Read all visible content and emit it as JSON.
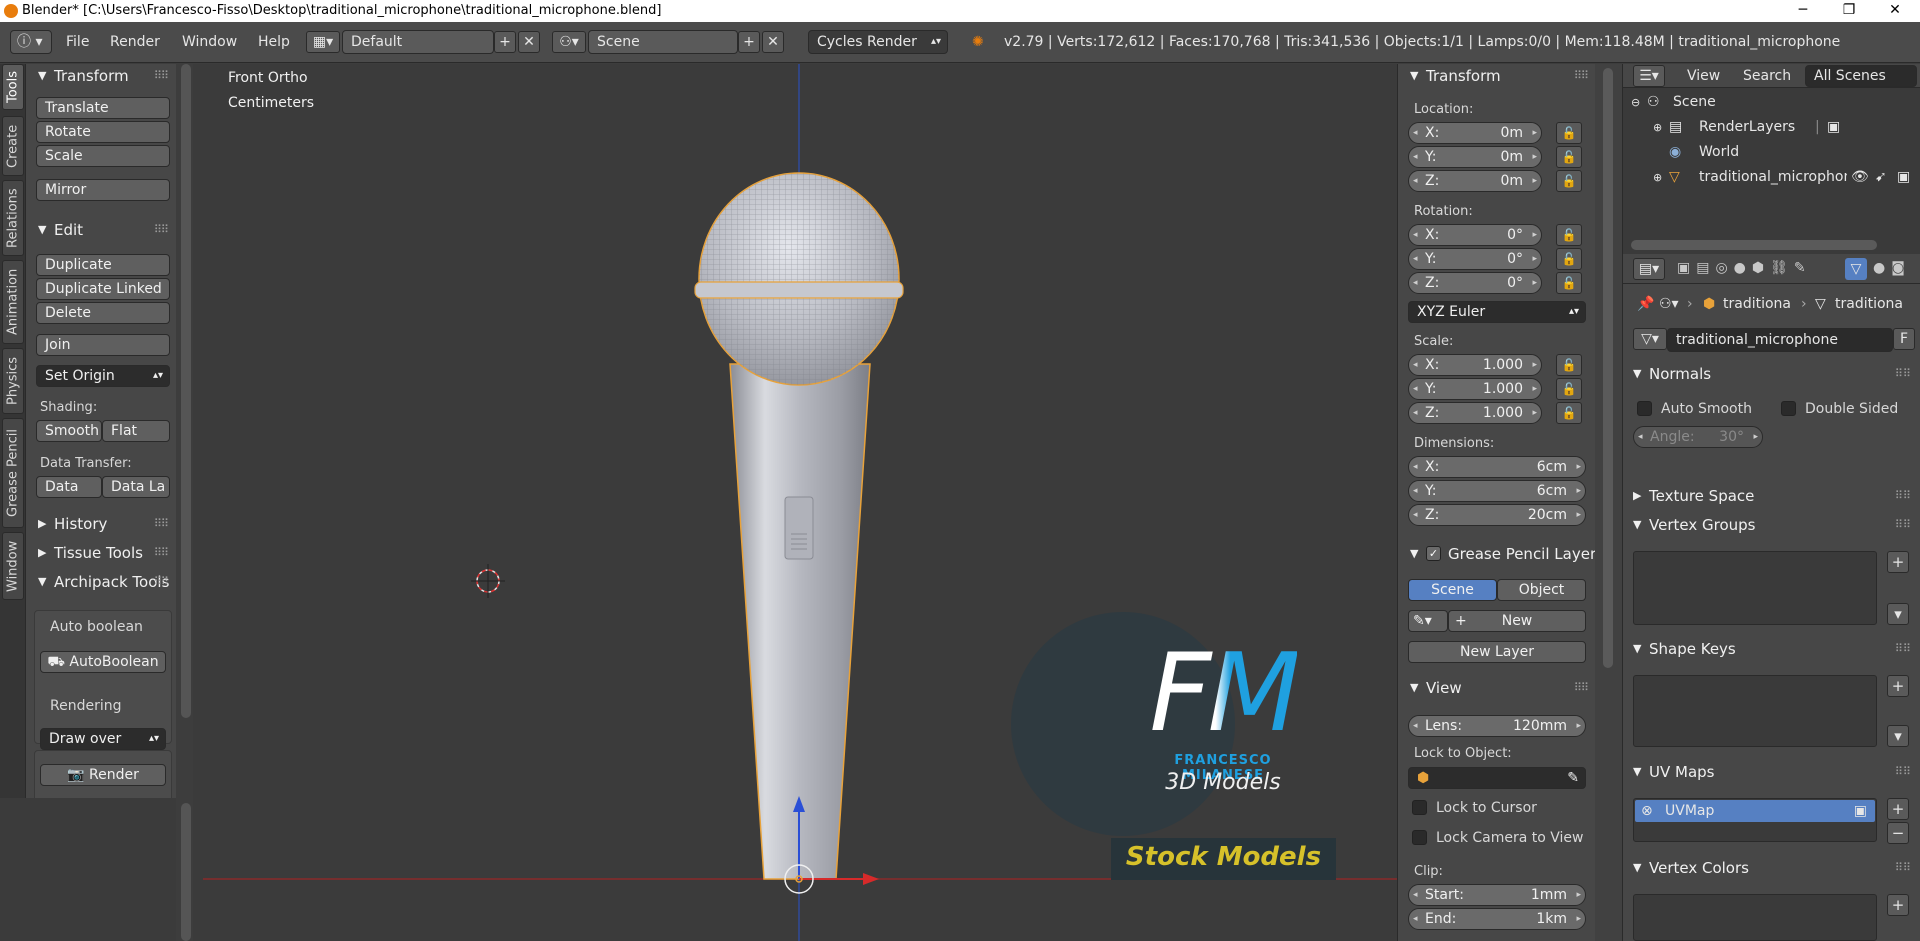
{
  "titlebar": {
    "title": "Blender* [C:\\Users\\Francesco-Fisso\\Desktop\\traditional_microphone\\traditional_microphone.blend]",
    "minimize": "─",
    "maximize": "❐",
    "close": "✕"
  },
  "menubar": {
    "info_icon": "ⓘ",
    "menus": [
      "File",
      "Render",
      "Window",
      "Help"
    ],
    "screen_layout": "Default",
    "scene": "Scene",
    "render_engine": "Cycles Render",
    "stats": "v2.79 | Verts:172,612 | Faces:170,768 | Tris:341,536 | Objects:1/1 | Lamps:0/0 | Mem:118.48M | traditional_microphone"
  },
  "left_tabs": [
    "Tools",
    "Create",
    "Relations",
    "Animation",
    "Physics",
    "Grease Pencil",
    "Window"
  ],
  "tool_shelf": {
    "transform": {
      "title": "Transform",
      "buttons": [
        "Translate",
        "Rotate",
        "Scale",
        "Mirror"
      ]
    },
    "edit": {
      "title": "Edit",
      "buttons": [
        "Duplicate",
        "Duplicate Linked",
        "Delete",
        "Join"
      ],
      "set_origin": "Set Origin",
      "shading_label": "Shading:",
      "smooth": "Smooth",
      "flat": "Flat",
      "data_transfer_label": "Data Transfer:",
      "data": "Data",
      "data_la": "Data La"
    },
    "history": "History",
    "tissue": "Tissue Tools",
    "archipack": "Archipack Tools",
    "auto_boolean_label": "Auto boolean",
    "auto_boolean_btn": "AutoBoolean",
    "rendering_label": "Rendering",
    "draw_over": "Draw over",
    "render_btn": "Render"
  },
  "viewport": {
    "view_name": "Front Ortho",
    "units": "Centimeters",
    "logo": {
      "letters": "FM",
      "name": "FRANCESCO MILANESE",
      "subtitle": "3D Models",
      "banner": "Stock Models"
    }
  },
  "npanel": {
    "transform_title": "Transform",
    "location_label": "Location:",
    "location": [
      {
        "k": "X:",
        "v": "0m"
      },
      {
        "k": "Y:",
        "v": "0m"
      },
      {
        "k": "Z:",
        "v": "0m"
      }
    ],
    "rotation_label": "Rotation:",
    "rotation": [
      {
        "k": "X:",
        "v": "0°"
      },
      {
        "k": "Y:",
        "v": "0°"
      },
      {
        "k": "Z:",
        "v": "0°"
      }
    ],
    "rotation_mode": "XYZ Euler",
    "scale_label": "Scale:",
    "scale": [
      {
        "k": "X:",
        "v": "1.000"
      },
      {
        "k": "Y:",
        "v": "1.000"
      },
      {
        "k": "Z:",
        "v": "1.000"
      }
    ],
    "dimensions_label": "Dimensions:",
    "dimensions": [
      {
        "k": "X:",
        "v": "6cm"
      },
      {
        "k": "Y:",
        "v": "6cm"
      },
      {
        "k": "Z:",
        "v": "20cm"
      }
    ],
    "grease_title": "Grease Pencil Layer",
    "scene_tab": "Scene",
    "object_tab": "Object",
    "new_btn": "New",
    "new_layer_btn": "New Layer",
    "view_title": "View",
    "lens_label": "Lens:",
    "lens_value": "120mm",
    "lock_to_object_label": "Lock to Object:",
    "lock_cursor": "Lock to Cursor",
    "lock_camera": "Lock Camera to View",
    "clip_label": "Clip:",
    "clip_start_label": "Start:",
    "clip_start": "1mm",
    "clip_end_label": "End:",
    "clip_end": "1km"
  },
  "outliner": {
    "view": "View",
    "search": "Search",
    "filter": "All Scenes",
    "items": [
      "Scene",
      "RenderLayers",
      "World",
      "traditional_microphone"
    ]
  },
  "properties": {
    "breadcrumb1": "traditiona",
    "breadcrumb2": "traditiona",
    "mesh_name": "traditional_microphone",
    "fake_user": "F",
    "normals": "Normals",
    "auto_smooth": "Auto Smooth",
    "double_sided": "Double Sided",
    "angle_label": "Angle:",
    "angle_value": "30°",
    "texture_space": "Texture Space",
    "vertex_groups": "Vertex Groups",
    "shape_keys": "Shape Keys",
    "uv_maps": "UV Maps",
    "uv_map_item": "UVMap",
    "vertex_colors": "Vertex Colors"
  },
  "colors": {
    "accent_blue": "#5680c2",
    "selection_orange": "#e8a23a",
    "logo_blue": "#1fa0e0",
    "banner_yellow": "#d6c12a"
  }
}
